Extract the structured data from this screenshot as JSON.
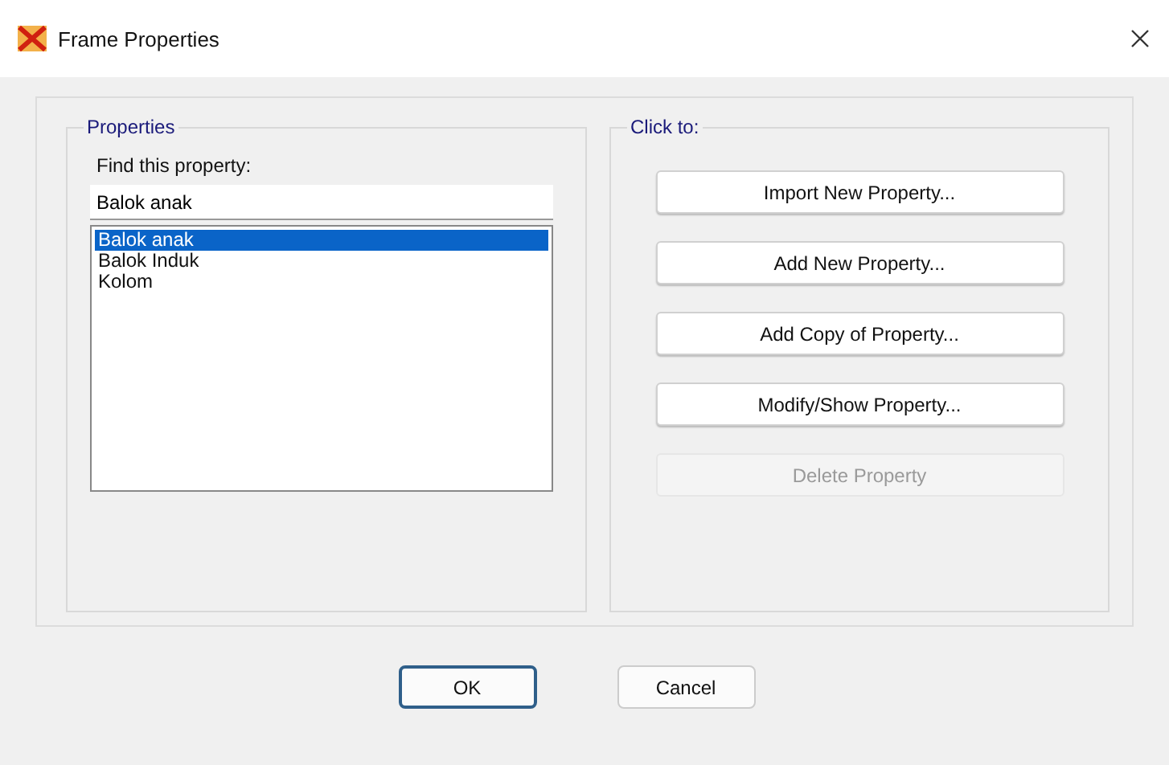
{
  "window": {
    "title": "Frame Properties"
  },
  "properties": {
    "legend": "Properties",
    "find_label": "Find this property:",
    "find_value": "Balok anak",
    "items": [
      {
        "label": "Balok anak",
        "selected": true
      },
      {
        "label": "Balok Induk",
        "selected": false
      },
      {
        "label": "Kolom",
        "selected": false
      }
    ]
  },
  "actions": {
    "legend": "Click to:",
    "buttons": [
      {
        "label": "Import New Property...",
        "disabled": false
      },
      {
        "label": "Add New Property...",
        "disabled": false
      },
      {
        "label": "Add Copy of Property...",
        "disabled": false
      },
      {
        "label": "Modify/Show Property...",
        "disabled": false
      },
      {
        "label": "Delete Property",
        "disabled": true
      }
    ]
  },
  "footer": {
    "buttons": [
      {
        "label": "OK",
        "default": true
      },
      {
        "label": "Cancel",
        "default": false
      }
    ]
  }
}
